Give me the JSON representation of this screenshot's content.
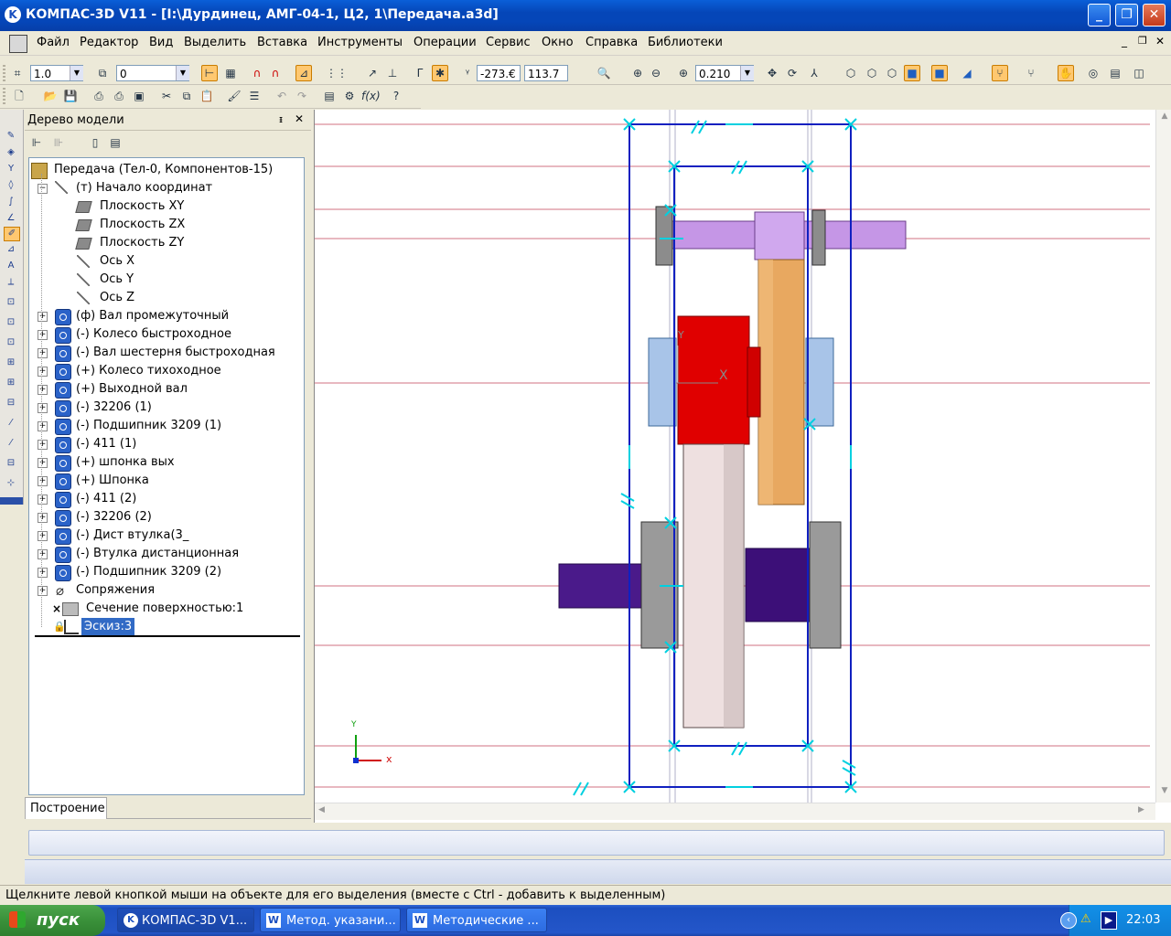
{
  "window": {
    "title": "КОМПАС-3D V11 - [I:\\Дурдинец, АМГ-04-1, Ц2, 1\\Передача.a3d]",
    "app_icon": "kompas-icon"
  },
  "menu": [
    "Файл",
    "Редактор",
    "Вид",
    "Выделить",
    "Вставка",
    "Инструменты",
    "Операции",
    "Сервис",
    "Окно",
    "Справка",
    "Библиотеки"
  ],
  "toolbar1": {
    "step_value": "1.0",
    "layer_value": "0",
    "coord_x": "-273.€",
    "coord_y": "113.7",
    "zoom_value": "0.210"
  },
  "tree": {
    "header": "Дерево модели",
    "root": "Передача (Тел-0, Компонентов-15)",
    "origin": "(т) Начало координат",
    "origin_children": [
      "Плоскость XY",
      "Плоскость ZX",
      "Плоскость ZY",
      "Ось X",
      "Ось Y",
      "Ось Z"
    ],
    "components": [
      "(ф) Вал промежуточный",
      "(-) Колесо быстроходное",
      "(-) Вал шестерня быстроходная",
      "(+) Колесо тихоходное",
      "(+) Выходной вал",
      "(-) 32206 (1)",
      "(-) Подшипник 3209 (1)",
      "(-) 411 (1)",
      "(+) шпонка вых",
      "(+) Шпонка",
      "(-) 411 (2)",
      "(-) 32206 (2)",
      "(-) Дист втулка(3_",
      "(-) Втулка дистанционная",
      "(-) Подшипник 3209 (2)"
    ],
    "mates": "Сопряжения",
    "section": "Сечение поверхностью:1",
    "sketch": "Эскиз:3",
    "tab": "Построение"
  },
  "viewport": {
    "axis_x": "X",
    "axis_y": "Y",
    "triad_x": "x",
    "triad_y": "Y"
  },
  "status_text": "Щелкните левой кнопкой мыши на объекте для его выделения (вместе с Ctrl - добавить к выделенным)",
  "taskbar": {
    "start": "пуск",
    "buttons": [
      "КОМПАС-3D V1...",
      "Метод. указани...",
      "Методические ..."
    ],
    "clock": "22:03"
  }
}
